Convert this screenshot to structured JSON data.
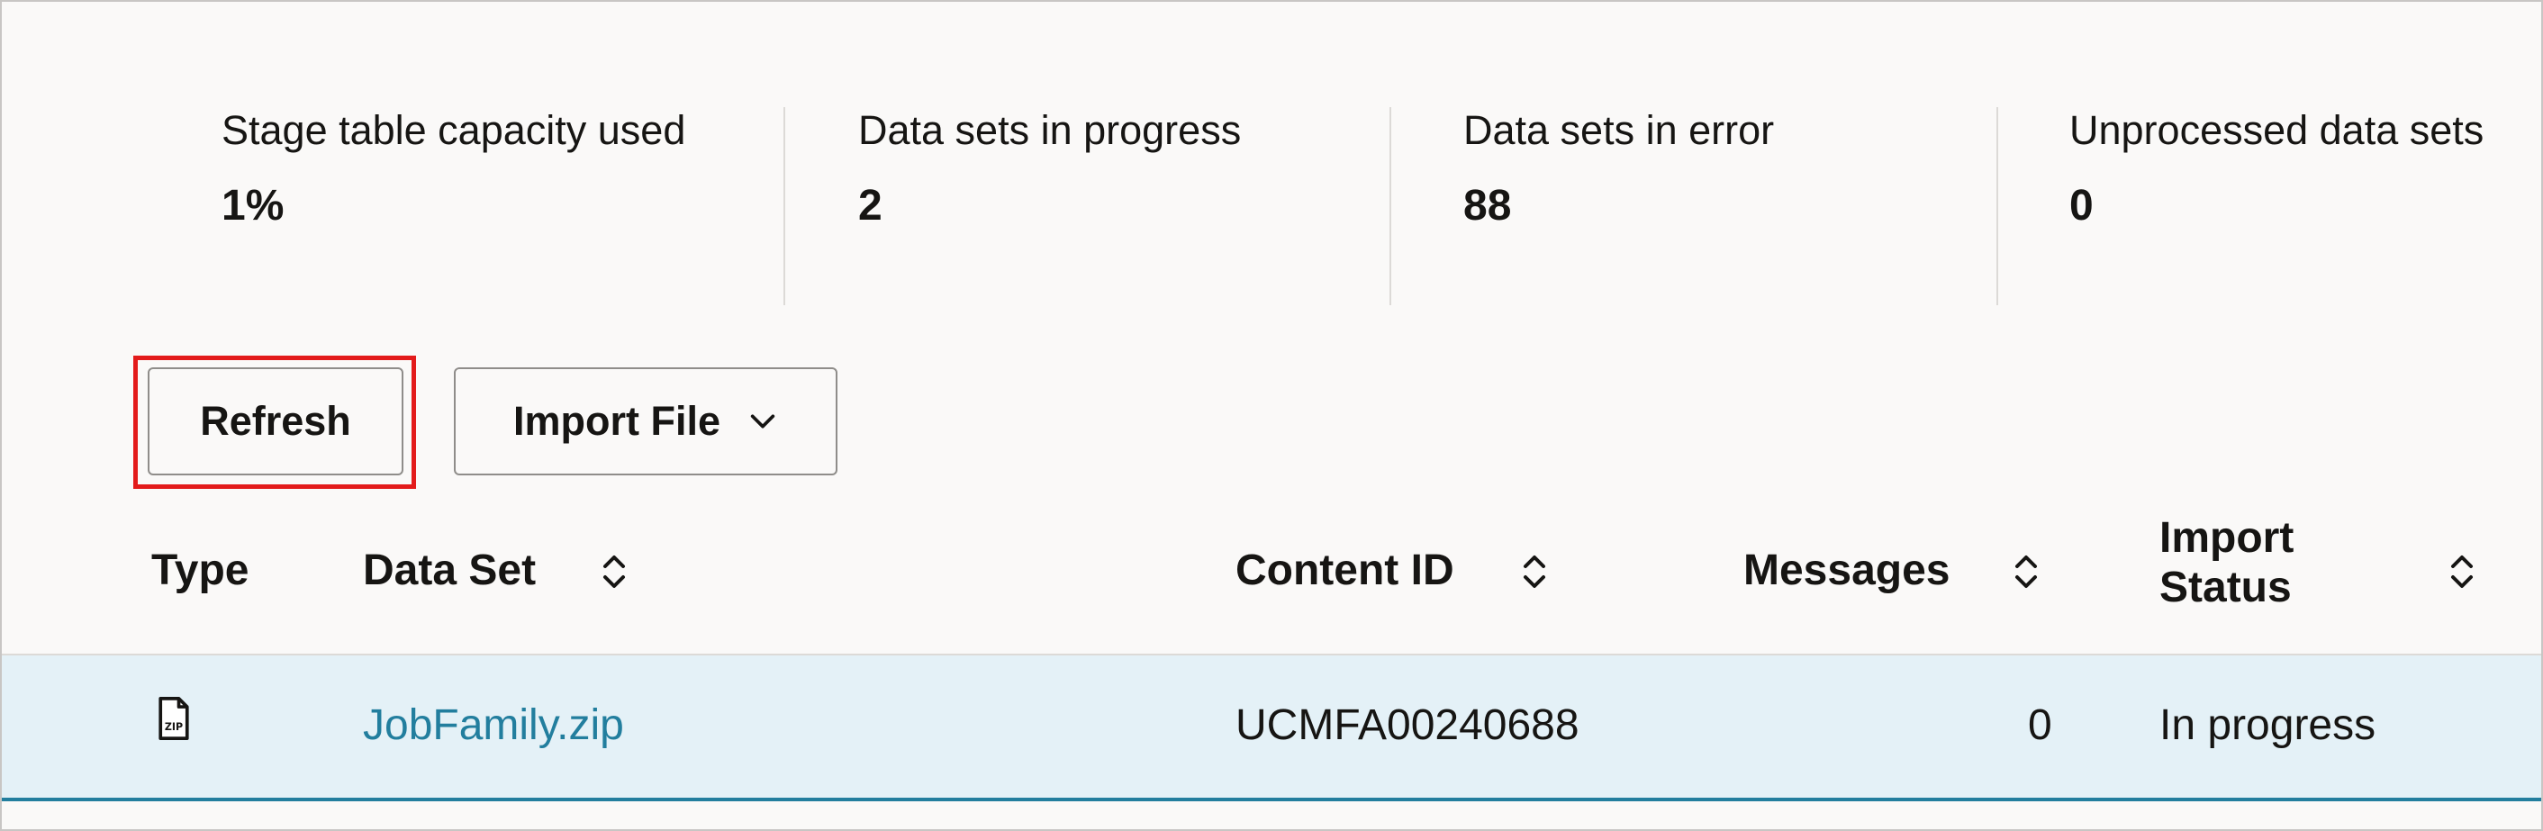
{
  "metrics": [
    {
      "label": "Stage table capacity used",
      "value": "1%"
    },
    {
      "label": "Data sets in progress",
      "value": "2"
    },
    {
      "label": "Data sets in error",
      "value": "88"
    },
    {
      "label": "Unprocessed data sets",
      "value": "0"
    }
  ],
  "toolbar": {
    "refresh_label": "Refresh",
    "import_label": "Import File"
  },
  "table": {
    "headers": {
      "type": "Type",
      "data_set": "Data Set",
      "content_id": "Content ID",
      "messages": "Messages",
      "import_status_line1": "Import",
      "import_status_line2": "Status"
    },
    "rows": [
      {
        "type_icon": "zip-file-icon",
        "data_set": "JobFamily.zip",
        "content_id": "UCMFA00240688",
        "messages": "0",
        "import_status": "In progress"
      }
    ]
  },
  "colors": {
    "highlight": "#e31b1b",
    "link": "#227e9e",
    "row_selected": "#e4f1f7"
  }
}
